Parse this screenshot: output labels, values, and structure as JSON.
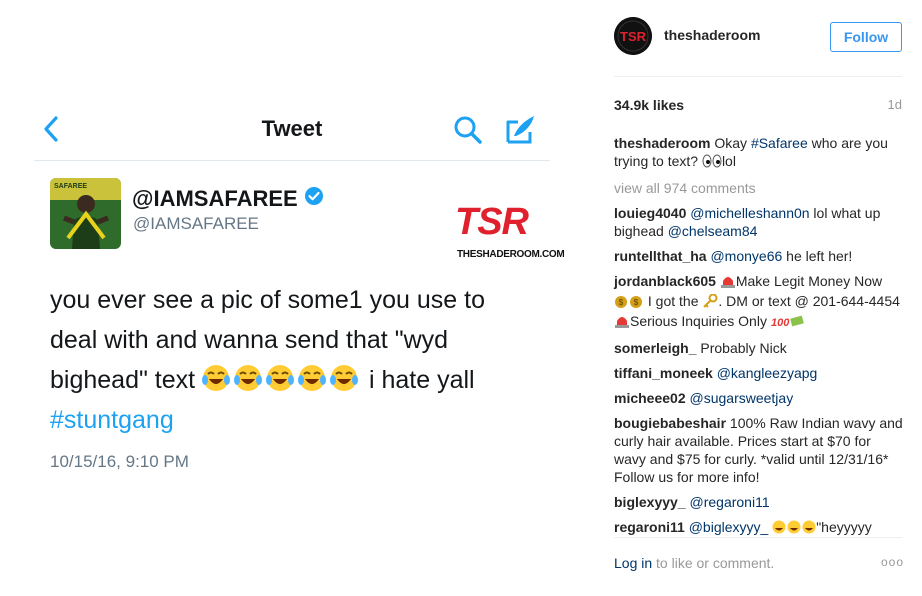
{
  "tweet": {
    "header_title": "Tweet",
    "name": "@IAMSAFAREE",
    "handle": "@IAMSAFAREE",
    "body_text": "you ever see a pic of some1 you use to deal with and wanna send that \"wyd bighead\" text",
    "body_after": " i hate yall",
    "hashtag": "#stuntgang",
    "timestamp": "10/15/16, 9:10 PM",
    "accent_color": "#1da1f2"
  },
  "watermark": {
    "logo_text": "TSR",
    "logo_sub": "THESHADEROOM.COM"
  },
  "instagram": {
    "username": "theshaderoom",
    "follow_label": "Follow",
    "likes": "34.9k likes",
    "age": "1d",
    "caption": {
      "user": "theshaderoom",
      "text_before": " Okay ",
      "hashtag": "#Safaree",
      "text_after": " who are you trying to text? ",
      "text_end": "lol"
    },
    "view_all": "view all 974 comments",
    "comments": [
      {
        "user": "louieg4040",
        "mention": "@michelleshann0n",
        "text": " lol what up bighead ",
        "mention2": "@chelseam84"
      },
      {
        "user": "runtellthat_ha",
        "mention": "@monye66",
        "text": " he left her!"
      },
      {
        "user": "jordanblack605",
        "p1": "Make Legit Money Now ",
        "p2": " I got the ",
        "p3": ". DM or text @ 201-644-4454",
        "p4": "Serious Inquiries Only "
      },
      {
        "user": "somerleigh_",
        "text": " Probably Nick"
      },
      {
        "user": "tiffani_moneek",
        "mention": "@kangleezyapg"
      },
      {
        "user": "micheee02",
        "mention": "@sugarsweetjay"
      },
      {
        "user": "bougiebabeshair",
        "text": " 100% Raw Indian wavy and curly hair available. Prices start at $70 for wavy and $75 for curly. *valid until 12/31/16* Follow us for more info!"
      },
      {
        "user": "biglexyyy_",
        "mention": "@regaroni11"
      },
      {
        "user": "regaroni11",
        "mention": "@biglexyyy_",
        "text": "\"heyyyyy"
      }
    ],
    "login_link": "Log in",
    "login_rest": " to like or comment.",
    "more": "ooo",
    "link_color": "#003569",
    "button_color": "#3897f0"
  }
}
